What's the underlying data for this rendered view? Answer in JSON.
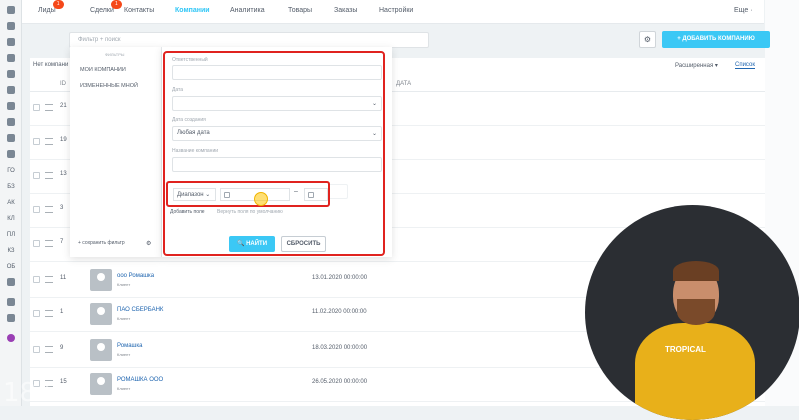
{
  "tabs": [
    {
      "label": "Лиды",
      "badge": "1"
    },
    {
      "label": "Сделки",
      "badge": "1"
    },
    {
      "label": "Контакты"
    },
    {
      "label": "Компании"
    },
    {
      "label": "Аналитика"
    },
    {
      "label": "Товары"
    },
    {
      "label": "Заказы"
    },
    {
      "label": "Настройки"
    }
  ],
  "more_label": "Еще ·",
  "rail_labels": [
    "ГО",
    "БЗ",
    "АК",
    "КЛ",
    "ПЛ",
    "КЗ",
    "ОБ"
  ],
  "filter_placeholder": "Фильтр + поиск",
  "add_button": "+ ДОБАВИТЬ КОМПАНИЮ",
  "gear_label": "⚙",
  "no_companies": "Нет компани",
  "view_mode": "Расширенная ▾",
  "view_list": "Список",
  "header_cols": {
    "id": "ID",
    "date": "ДАТА"
  },
  "sidebar": {
    "title": "ФИЛЬТРЫ",
    "items": [
      "МОИ КОМПАНИИ",
      "ИЗМЕНЕННЫЕ МНОЙ"
    ],
    "save_label": "+ сохранить фильтр"
  },
  "filter_panel": {
    "responsible_label": "Ответственный",
    "date_label": "Дата",
    "date_created_label": "Дата создания",
    "date_created_value": "Любая дата",
    "company_name_label": "Название компании",
    "range_select": "Диапазон",
    "add_field": "Добавить поле",
    "restore_default": "Вернуть поля по умолчанию",
    "find_button": "НАЙТИ",
    "reset_button": "СБРОСИТЬ"
  },
  "rows": [
    {
      "id": "21"
    },
    {
      "id": "19"
    },
    {
      "id": "13"
    },
    {
      "id": "3"
    },
    {
      "id": "7"
    },
    {
      "id": "11",
      "name": "ооо Ромашка",
      "sub": "Клиент",
      "date": "13.01.2020 00:00:00"
    },
    {
      "id": "1",
      "name": "ПАО СБЕРБАНК",
      "sub": "Клиент",
      "date": "11.02.2020 00:00:00"
    },
    {
      "id": "9",
      "name": "Ромашка",
      "sub": "Клиент",
      "date": "18.03.2020 00:00:00"
    },
    {
      "id": "15",
      "name": "РОМАШКА ООО",
      "sub": "Клиент",
      "date": "26.05.2020 00:00:00"
    }
  ],
  "video": {
    "shirt_text": "TROPICAL"
  },
  "watermark": "18+",
  "colors": {
    "accent": "#3bc8f5",
    "highlight": "#e0231f",
    "badge": "#f54819"
  }
}
